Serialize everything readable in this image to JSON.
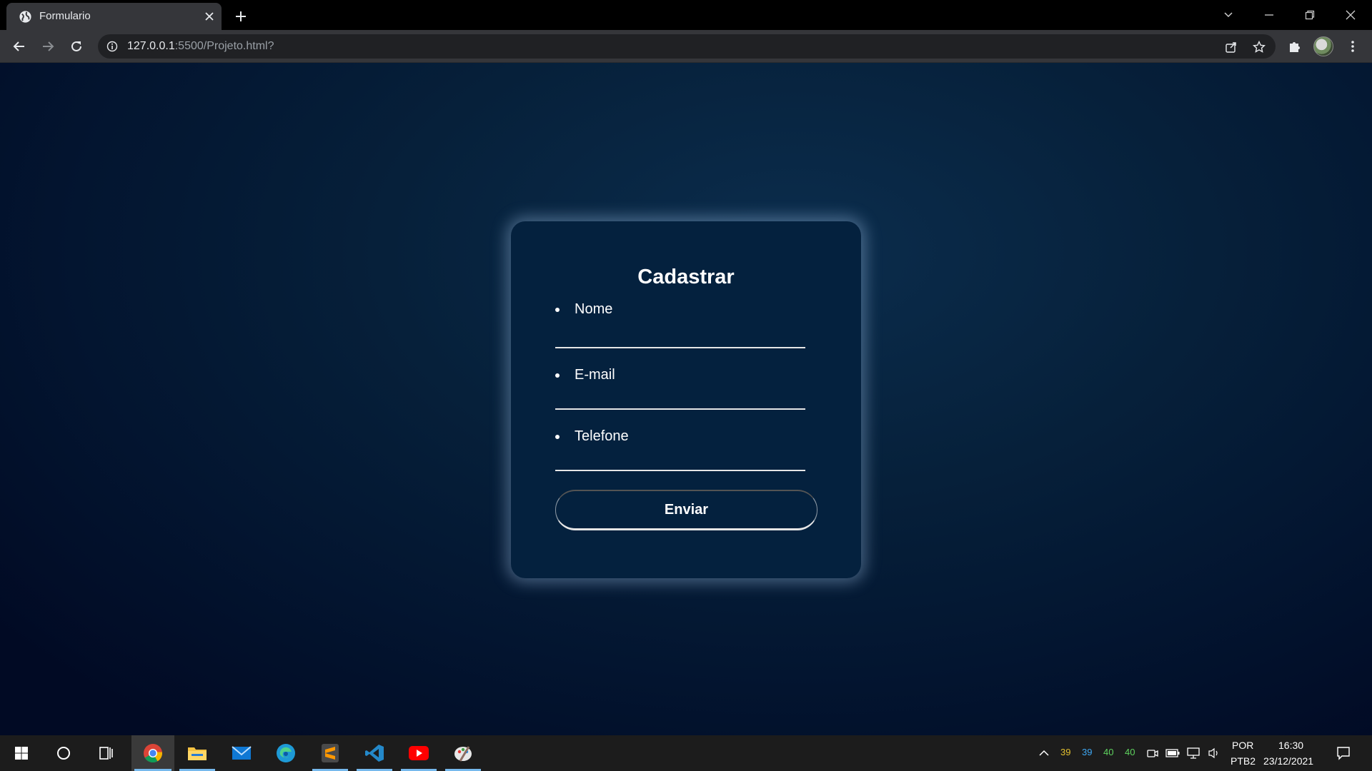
{
  "browser": {
    "tab_title": "Formulario",
    "url_host": "127.0.0.1",
    "url_rest": ":5500/Projeto.html?"
  },
  "page": {
    "title": "Cadastrar",
    "fields": [
      {
        "label": "Nome"
      },
      {
        "label": "E-mail"
      },
      {
        "label": "Telefone"
      }
    ],
    "submit_label": "Enviar"
  },
  "taskbar": {
    "apps": [
      "start-icon",
      "search-icon",
      "task-view-icon",
      "chrome-icon",
      "file-explorer-icon",
      "mail-icon",
      "edge-icon",
      "sublime-text-icon",
      "vscode-icon",
      "youtube-icon",
      "paint-icon"
    ],
    "tray_numbers": [
      {
        "value": "39",
        "color": "#e3c02f"
      },
      {
        "value": "39",
        "color": "#3fa9f5"
      },
      {
        "value": "40",
        "color": "#5fd35f"
      },
      {
        "value": "40",
        "color": "#5fd35f"
      }
    ],
    "language": "POR",
    "keyboard": "PTB2",
    "time": "16:30",
    "date": "23/12/2021"
  }
}
